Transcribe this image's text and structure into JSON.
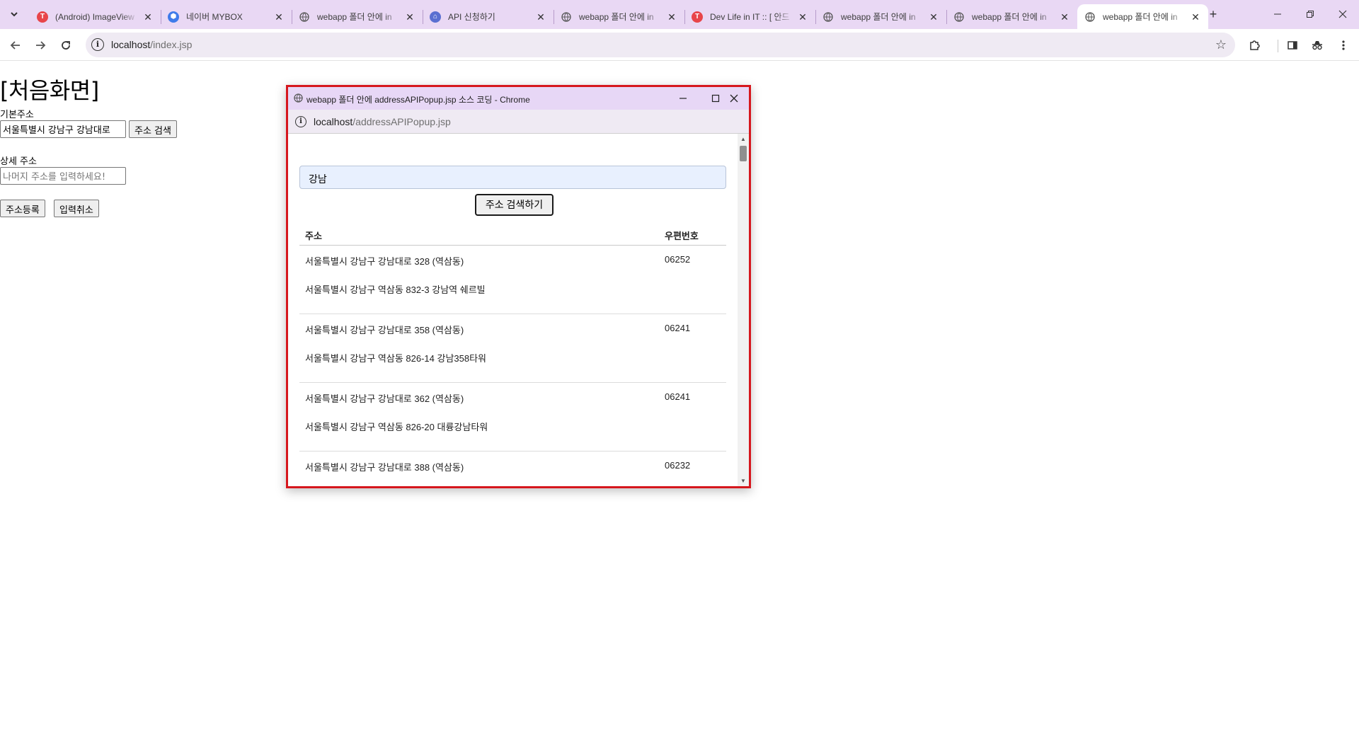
{
  "browser": {
    "tabs": [
      {
        "title": "(Android) ImageView",
        "favicon": "tistory-icon",
        "color": "#e8454a",
        "glyph": "T",
        "active": false
      },
      {
        "title": "네이버 MYBOX",
        "favicon": "mybox-icon",
        "color": "#3f7bea",
        "glyph": "⬢",
        "active": false
      },
      {
        "title": "webapp 폴더 안에 in",
        "favicon": "globe-icon",
        "color": "#6b6b6b",
        "glyph": "🌐",
        "active": false
      },
      {
        "title": "API 신청하기",
        "favicon": "juso-icon",
        "color": "#5a6fd1",
        "glyph": "⌂",
        "active": false
      },
      {
        "title": "webapp 폴더 안에 in",
        "favicon": "globe-icon",
        "color": "#6b6b6b",
        "glyph": "🌐",
        "active": false
      },
      {
        "title": "Dev Life in IT :: [ 안드",
        "favicon": "tistory-icon",
        "color": "#e8454a",
        "glyph": "T",
        "active": false
      },
      {
        "title": "webapp 폴더 안에 in",
        "favicon": "globe-icon",
        "color": "#6b6b6b",
        "glyph": "🌐",
        "active": false
      },
      {
        "title": "webapp 폴더 안에 in",
        "favicon": "globe-icon",
        "color": "#6b6b6b",
        "glyph": "🌐",
        "active": false
      },
      {
        "title": "webapp 폴더 안에 in",
        "favicon": "globe-icon",
        "color": "#6b6b6b",
        "glyph": "🌐",
        "active": true
      }
    ],
    "url_host": "localhost",
    "url_path": "/index.jsp"
  },
  "page": {
    "heading": "[처음화면]",
    "basic_address_label": "기본주소",
    "basic_address_value": "서울특별시 강남구 강남대로",
    "address_search_button": "주소 검색",
    "detail_address_label": "상세 주소",
    "detail_address_placeholder": "나머지 주소를 입력하세요!",
    "register_button": "주소등록",
    "cancel_button": "입력취소"
  },
  "popup": {
    "window_title": "webapp 폴더 안에 addressAPIPopup.jsp 소스 코딩 - Chrome",
    "url_host": "localhost",
    "url_path": "/addressAPIPopup.jsp",
    "search_value": "강남",
    "search_button": "주소 검색하기",
    "table": {
      "col_address": "주소",
      "col_zip": "우편번호",
      "rows": [
        {
          "road": "서울특별시 강남구 강남대로 328 (역삼동)",
          "zip": "06252",
          "jibun": "서울특별시 강남구 역삼동 832-3 강남역 쉐르빌"
        },
        {
          "road": "서울특별시 강남구 강남대로 358 (역삼동)",
          "zip": "06241",
          "jibun": "서울특별시 강남구 역삼동 826-14 강남358타워"
        },
        {
          "road": "서울특별시 강남구 강남대로 362 (역삼동)",
          "zip": "06241",
          "jibun": "서울특별시 강남구 역삼동 826-20 대륭강남타워"
        },
        {
          "road": "서울특별시 강남구 강남대로 388 (역삼동)",
          "zip": "06232",
          "jibun": ""
        }
      ]
    }
  }
}
